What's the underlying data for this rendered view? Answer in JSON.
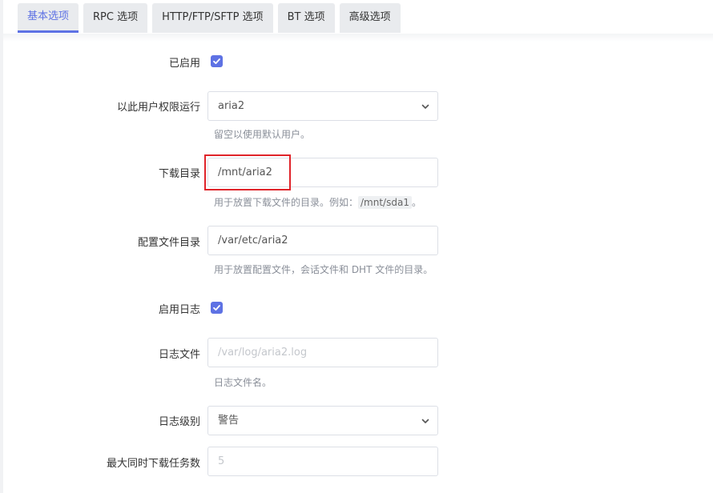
{
  "tabs": [
    {
      "label": "基本选项",
      "active": true
    },
    {
      "label": "RPC 选项",
      "active": false
    },
    {
      "label": "HTTP/FTP/SFTP 选项",
      "active": false
    },
    {
      "label": "BT 选项",
      "active": false
    },
    {
      "label": "高级选项",
      "active": false
    }
  ],
  "accent_color": "#5e72e4",
  "form": {
    "enabled": {
      "label": "已启用",
      "checked": true
    },
    "run_as_user": {
      "label": "以此用户权限运行",
      "value": "aria2",
      "help": "留空以使用默认用户。"
    },
    "download_dir": {
      "label": "下载目录",
      "value": "/mnt/aria2",
      "help_prefix": "用于放置下载文件的目录。例如：",
      "help_code": "/mnt/sda1",
      "help_suffix": "。"
    },
    "config_dir": {
      "label": "配置文件目录",
      "value": "/var/etc/aria2",
      "help": "用于放置配置文件，会话文件和 DHT 文件的目录。"
    },
    "enable_log": {
      "label": "启用日志",
      "checked": true
    },
    "log_file": {
      "label": "日志文件",
      "placeholder": "/var/log/aria2.log",
      "help": "日志文件名。"
    },
    "log_level": {
      "label": "日志级别",
      "value": "警告"
    },
    "max_concurrent": {
      "label": "最大同时下载任务数",
      "placeholder": "5"
    }
  }
}
